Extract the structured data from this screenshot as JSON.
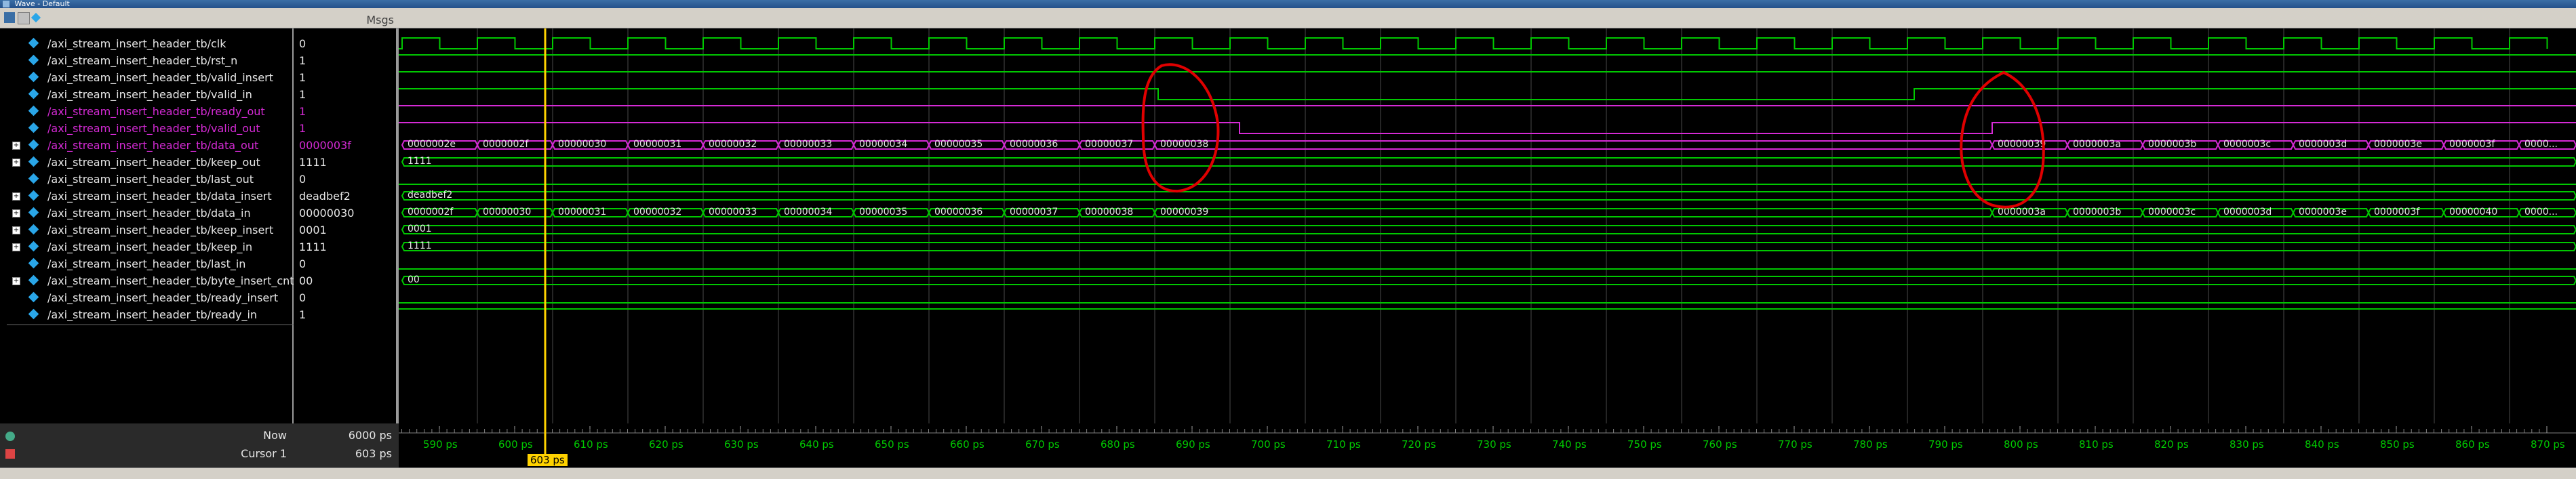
{
  "window": {
    "title": "Wave - Default"
  },
  "header": {
    "msgs_label": "Msgs"
  },
  "signals": [
    {
      "name": "/axi_stream_insert_header_tb/clk",
      "value": "0",
      "bus": false,
      "pink": false
    },
    {
      "name": "/axi_stream_insert_header_tb/rst_n",
      "value": "1",
      "bus": false,
      "pink": false
    },
    {
      "name": "/axi_stream_insert_header_tb/valid_insert",
      "value": "1",
      "bus": false,
      "pink": false
    },
    {
      "name": "/axi_stream_insert_header_tb/valid_in",
      "value": "1",
      "bus": false,
      "pink": false
    },
    {
      "name": "/axi_stream_insert_header_tb/ready_out",
      "value": "1",
      "bus": false,
      "pink": true
    },
    {
      "name": "/axi_stream_insert_header_tb/valid_out",
      "value": "1",
      "bus": false,
      "pink": true
    },
    {
      "name": "/axi_stream_insert_header_tb/data_out",
      "value": "0000003f",
      "bus": true,
      "pink": true
    },
    {
      "name": "/axi_stream_insert_header_tb/keep_out",
      "value": "1111",
      "bus": true,
      "pink": false
    },
    {
      "name": "/axi_stream_insert_header_tb/last_out",
      "value": "0",
      "bus": false,
      "pink": false
    },
    {
      "name": "/axi_stream_insert_header_tb/data_insert",
      "value": "deadbef2",
      "bus": true,
      "pink": false
    },
    {
      "name": "/axi_stream_insert_header_tb/data_in",
      "value": "00000030",
      "bus": true,
      "pink": false
    },
    {
      "name": "/axi_stream_insert_header_tb/keep_insert",
      "value": "0001",
      "bus": true,
      "pink": false
    },
    {
      "name": "/axi_stream_insert_header_tb/keep_in",
      "value": "1111",
      "bus": true,
      "pink": false
    },
    {
      "name": "/axi_stream_insert_header_tb/last_in",
      "value": "0",
      "bus": false,
      "pink": false
    },
    {
      "name": "/axi_stream_insert_header_tb/byte_insert_cnt",
      "value": "00",
      "bus": true,
      "pink": false
    },
    {
      "name": "/axi_stream_insert_header_tb/ready_insert",
      "value": "0",
      "bus": false,
      "pink": false
    },
    {
      "name": "/axi_stream_insert_header_tb/ready_in",
      "value": "1",
      "bus": false,
      "pink": false
    }
  ],
  "waves": {
    "data_out_labels": [
      "0000002e",
      "0000002f",
      "00000030",
      "00000031",
      "00000032",
      "00000033",
      "00000034",
      "00000035",
      "00000036",
      "00000037",
      "00000038",
      "00000039",
      "0000003a",
      "0000003b",
      "0000003c",
      "0000003d",
      "0000003e",
      "0000003f",
      "0000..."
    ],
    "keep_out_label": "1111",
    "data_insert_label": "deadbef2",
    "data_in_labels": [
      "0000002f",
      "00000030",
      "00000031",
      "00000032",
      "00000033",
      "00000034",
      "00000035",
      "00000036",
      "00000037",
      "00000038",
      "00000039",
      "0000003a",
      "0000003b",
      "0000003c",
      "0000003d",
      "0000003e",
      "0000003f",
      "00000040",
      "0000..."
    ],
    "keep_insert_label": "0001",
    "keep_in_label": "1111",
    "byte_insert_cnt_label": "00"
  },
  "timeline": {
    "ticks": [
      "590 ps",
      "600 ps",
      "610 ps",
      "620 ps",
      "630 ps",
      "640 ps",
      "650 ps",
      "660 ps",
      "670 ps",
      "680 ps",
      "690 ps",
      "700 ps",
      "710 ps",
      "720 ps",
      "730 ps",
      "740 ps",
      "750 ps",
      "760 ps",
      "770 ps",
      "780 ps",
      "790 ps",
      "800 ps",
      "810 ps",
      "820 ps",
      "830 ps",
      "840 ps",
      "850 ps",
      "860 ps",
      "870 ps"
    ],
    "now_label": "Now",
    "now_value": "6000 ps",
    "cursor_label": "Cursor 1",
    "cursor_value": "603 ps",
    "cursor_badge": "603 ps"
  },
  "colors": {
    "wave": "#00c800",
    "pink": "#d52ad5",
    "cursor": "#ffd200",
    "annotation": "#e00000"
  }
}
